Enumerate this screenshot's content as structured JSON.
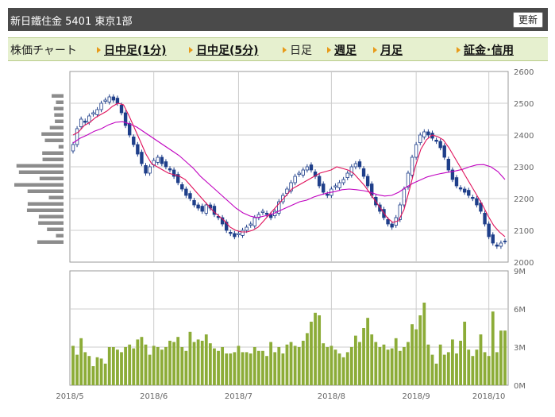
{
  "header": {
    "title": "新日鐵住金 5401 東京1部",
    "refresh_label": "更新"
  },
  "tabs": [
    {
      "label": "株価チャート",
      "link": false,
      "arrow": false
    },
    {
      "label": "日中足(1分)",
      "link": true,
      "arrow": true
    },
    {
      "label": "日中足(5分)",
      "link": true,
      "arrow": true
    },
    {
      "label": "日足",
      "link": false,
      "arrow": true
    },
    {
      "label": "週足",
      "link": true,
      "arrow": true
    },
    {
      "label": "月足",
      "link": true,
      "arrow": true
    },
    {
      "label": "証金･信用",
      "link": true,
      "arrow": true
    }
  ],
  "colors": {
    "candle": "#1f3f8a",
    "ma_short": "#e0105a",
    "ma_long": "#c000c0",
    "volume": "#8cac38",
    "vol_profile": "#8c8c8c",
    "grid": "#cccccc"
  },
  "chart_data": {
    "type": "candlestick",
    "price_ylim": [
      2000,
      2600
    ],
    "price_ticks": [
      "2000",
      "2100",
      "2200",
      "2300",
      "2400",
      "2500",
      "2600"
    ],
    "volume_ylim": [
      0,
      9
    ],
    "volume_ticks": [
      "0M",
      "3M",
      "6M",
      "9M"
    ],
    "x_ticks": [
      "2018/5",
      "2018/6",
      "2018/7",
      "2018/8",
      "2018/9",
      "2018/10"
    ],
    "close": [
      2370,
      2420,
      2450,
      2440,
      2460,
      2470,
      2480,
      2500,
      2510,
      2520,
      2510,
      2500,
      2470,
      2430,
      2400,
      2370,
      2340,
      2310,
      2280,
      2300,
      2320,
      2330,
      2310,
      2300,
      2290,
      2270,
      2250,
      2230,
      2210,
      2200,
      2180,
      2170,
      2160,
      2180,
      2170,
      2150,
      2140,
      2120,
      2100,
      2090,
      2080,
      2090,
      2100,
      2110,
      2120,
      2140,
      2150,
      2160,
      2150,
      2140,
      2160,
      2190,
      2210,
      2230,
      2250,
      2270,
      2280,
      2290,
      2300,
      2290,
      2270,
      2240,
      2220,
      2210,
      2230,
      2240,
      2250,
      2260,
      2280,
      2300,
      2310,
      2300,
      2270,
      2240,
      2210,
      2180,
      2160,
      2140,
      2120,
      2110,
      2140,
      2180,
      2230,
      2280,
      2330,
      2370,
      2400,
      2410,
      2400,
      2390,
      2380,
      2360,
      2330,
      2290,
      2260,
      2240,
      2230,
      2220,
      2210,
      2200,
      2180,
      2160,
      2120,
      2080,
      2060,
      2050,
      2060,
      2065
    ],
    "volume": [
      3.1,
      2.4,
      3.7,
      2.6,
      2.3,
      1.5,
      2.2,
      2.1,
      1.7,
      3.0,
      3.0,
      2.8,
      2.6,
      3.0,
      3.2,
      2.9,
      3.6,
      3.8,
      3.2,
      2.4,
      3.1,
      3.0,
      2.8,
      3.0,
      3.5,
      3.4,
      3.8,
      3.0,
      2.7,
      4.2,
      3.4,
      3.6,
      3.5,
      4.0,
      3.3,
      2.9,
      2.7,
      3.0,
      2.5,
      2.5,
      2.6,
      3.1,
      2.6,
      2.6,
      2.5,
      3.0,
      2.7,
      2.7,
      2.3,
      3.4,
      2.6,
      3.0,
      2.5,
      3.2,
      3.4,
      3.1,
      3.0,
      3.5,
      4.1,
      5.0,
      5.7,
      5.5,
      3.3,
      3.0,
      3.1,
      2.8,
      2.5,
      2.2,
      2.6,
      3.0,
      3.9,
      3.4,
      4.5,
      5.3,
      4.0,
      3.4,
      3.0,
      3.2,
      2.8,
      2.9,
      3.7,
      2.7,
      3.0,
      3.4,
      4.8,
      4.4,
      5.5,
      6.5,
      3.2,
      2.4,
      1.7,
      3.2,
      2.4,
      2.6,
      3.6,
      2.5,
      3.5,
      5.0,
      2.8,
      2.3,
      2.8,
      4.0,
      2.6,
      2.3,
      5.8,
      2.6,
      4.3,
      4.3
    ],
    "ma_short": [
      2400,
      2410,
      2430,
      2440,
      2455,
      2465,
      2475,
      2490,
      2500,
      2495,
      2460,
      2420,
      2380,
      2340,
      2310,
      2300,
      2290,
      2280,
      2275,
      2270,
      2260,
      2240,
      2220,
      2200,
      2180,
      2160,
      2145,
      2130,
      2110,
      2100,
      2095,
      2095,
      2100,
      2110,
      2130,
      2150,
      2170,
      2190,
      2210,
      2230,
      2240,
      2250,
      2260,
      2270,
      2280,
      2285,
      2290,
      2300,
      2295,
      2290,
      2280,
      2260,
      2240,
      2215,
      2190,
      2165,
      2140,
      2125,
      2130,
      2165,
      2230,
      2300,
      2355,
      2385,
      2400,
      2395,
      2385,
      2360,
      2330,
      2300,
      2270,
      2240,
      2210,
      2180,
      2145,
      2115,
      2095,
      2080
    ],
    "ma_long": [
      2375,
      2390,
      2400,
      2412,
      2420,
      2432,
      2440,
      2442,
      2435,
      2425,
      2410,
      2395,
      2380,
      2365,
      2350,
      2335,
      2315,
      2295,
      2270,
      2250,
      2230,
      2210,
      2190,
      2170,
      2155,
      2145,
      2140,
      2145,
      2150,
      2160,
      2170,
      2180,
      2190,
      2195,
      2205,
      2212,
      2218,
      2222,
      2228,
      2230,
      2228,
      2225,
      2220,
      2212,
      2208,
      2210,
      2220,
      2235,
      2248,
      2258,
      2268,
      2274,
      2279,
      2283,
      2287,
      2292,
      2300,
      2306,
      2307,
      2300,
      2285,
      2260
    ]
  }
}
